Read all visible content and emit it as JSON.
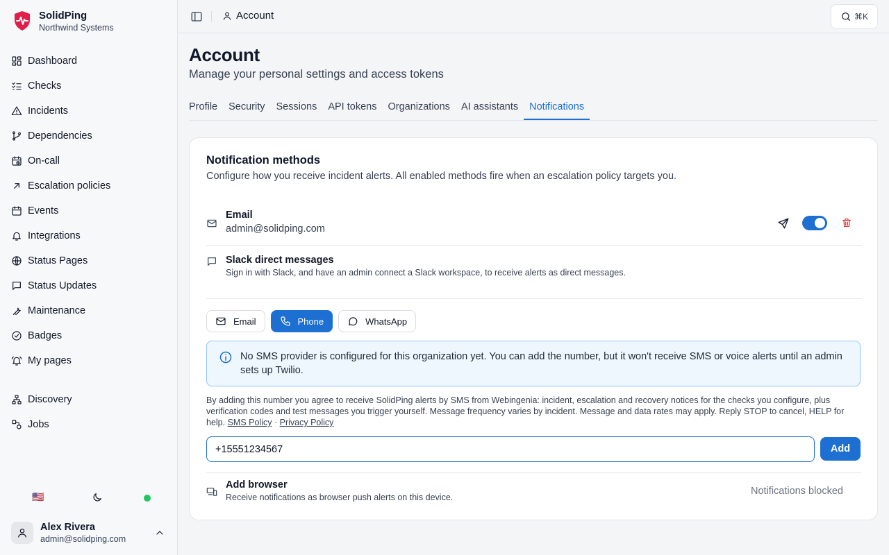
{
  "sidebar": {
    "brand": {
      "name": "SolidPing",
      "org": "Northwind Systems",
      "logo_icon": "shield-heartbeat-logo",
      "logo_color": "#e11d48"
    },
    "items": [
      {
        "label": "Dashboard",
        "icon": "dashboard-icon"
      },
      {
        "label": "Checks",
        "icon": "checklist-icon"
      },
      {
        "label": "Incidents",
        "icon": "warning-icon"
      },
      {
        "label": "Dependencies",
        "icon": "dependencies-icon"
      },
      {
        "label": "On-call",
        "icon": "calendar-clock-icon"
      },
      {
        "label": "Escalation policies",
        "icon": "arrow-up-right-icon"
      },
      {
        "label": "Events",
        "icon": "calendar-icon"
      },
      {
        "label": "Integrations",
        "icon": "bell-icon"
      },
      {
        "label": "Status Pages",
        "icon": "globe-icon"
      },
      {
        "label": "Status Updates",
        "icon": "message-icon"
      },
      {
        "label": "Maintenance",
        "icon": "wrench-icon"
      },
      {
        "label": "Badges",
        "icon": "check-circle-icon"
      },
      {
        "label": "My pages",
        "icon": "bell-ring-icon"
      },
      {
        "label": "Discovery",
        "icon": "network-icon"
      },
      {
        "label": "Jobs",
        "icon": "jobs-icon"
      }
    ],
    "bottom": {
      "flag": "🇺🇸",
      "theme_icon": "moon-icon",
      "status_color": "#22c55e"
    },
    "user": {
      "name": "Alex Rivera",
      "email": "admin@solidping.com"
    }
  },
  "topbar": {
    "breadcrumb": "Account",
    "search_shortcut": "⌘K"
  },
  "page": {
    "title": "Account",
    "subtitle": "Manage your personal settings and access tokens",
    "tabs": [
      {
        "label": "Profile",
        "active": false
      },
      {
        "label": "Security",
        "active": false
      },
      {
        "label": "Sessions",
        "active": false
      },
      {
        "label": "API tokens",
        "active": false
      },
      {
        "label": "Organizations",
        "active": false
      },
      {
        "label": "AI assistants",
        "active": false
      },
      {
        "label": "Notifications",
        "active": true
      }
    ]
  },
  "card": {
    "title": "Notification methods",
    "description": "Configure how you receive incident alerts. All enabled methods fire when an escalation policy targets you.",
    "email": {
      "title": "Email",
      "address": "admin@solidping.com",
      "enabled": true
    },
    "slack": {
      "title": "Slack direct messages",
      "description": "Sign in with Slack, and have an admin connect a Slack workspace, to receive alerts as direct messages."
    },
    "channels": [
      {
        "label": "Email",
        "icon": "mail-icon",
        "active": false
      },
      {
        "label": "Phone",
        "icon": "phone-icon",
        "active": true
      },
      {
        "label": "WhatsApp",
        "icon": "whatsapp-icon",
        "active": false
      }
    ],
    "alert": "No SMS provider is configured for this organization yet. You can add the number, but it won't receive SMS or voice alerts until an admin sets up Twilio.",
    "consent": {
      "text": "By adding this number you agree to receive SolidPing alerts by SMS from Webingenia: incident, escalation and recovery notices for the checks you configure, plus verification codes and test messages you trigger yourself. Message frequency varies by incident. Message and data rates may apply. Reply STOP to cancel, HELP for help.",
      "sms_policy": "SMS Policy",
      "separator": "·",
      "privacy_policy": "Privacy Policy"
    },
    "phone_value": "+15551234567",
    "add_label": "Add",
    "browser": {
      "title": "Add browser",
      "description": "Receive notifications as browser push alerts on this device.",
      "status": "Notifications blocked"
    }
  },
  "colors": {
    "accent": "#1d6fd1",
    "danger": "#dc2626"
  }
}
